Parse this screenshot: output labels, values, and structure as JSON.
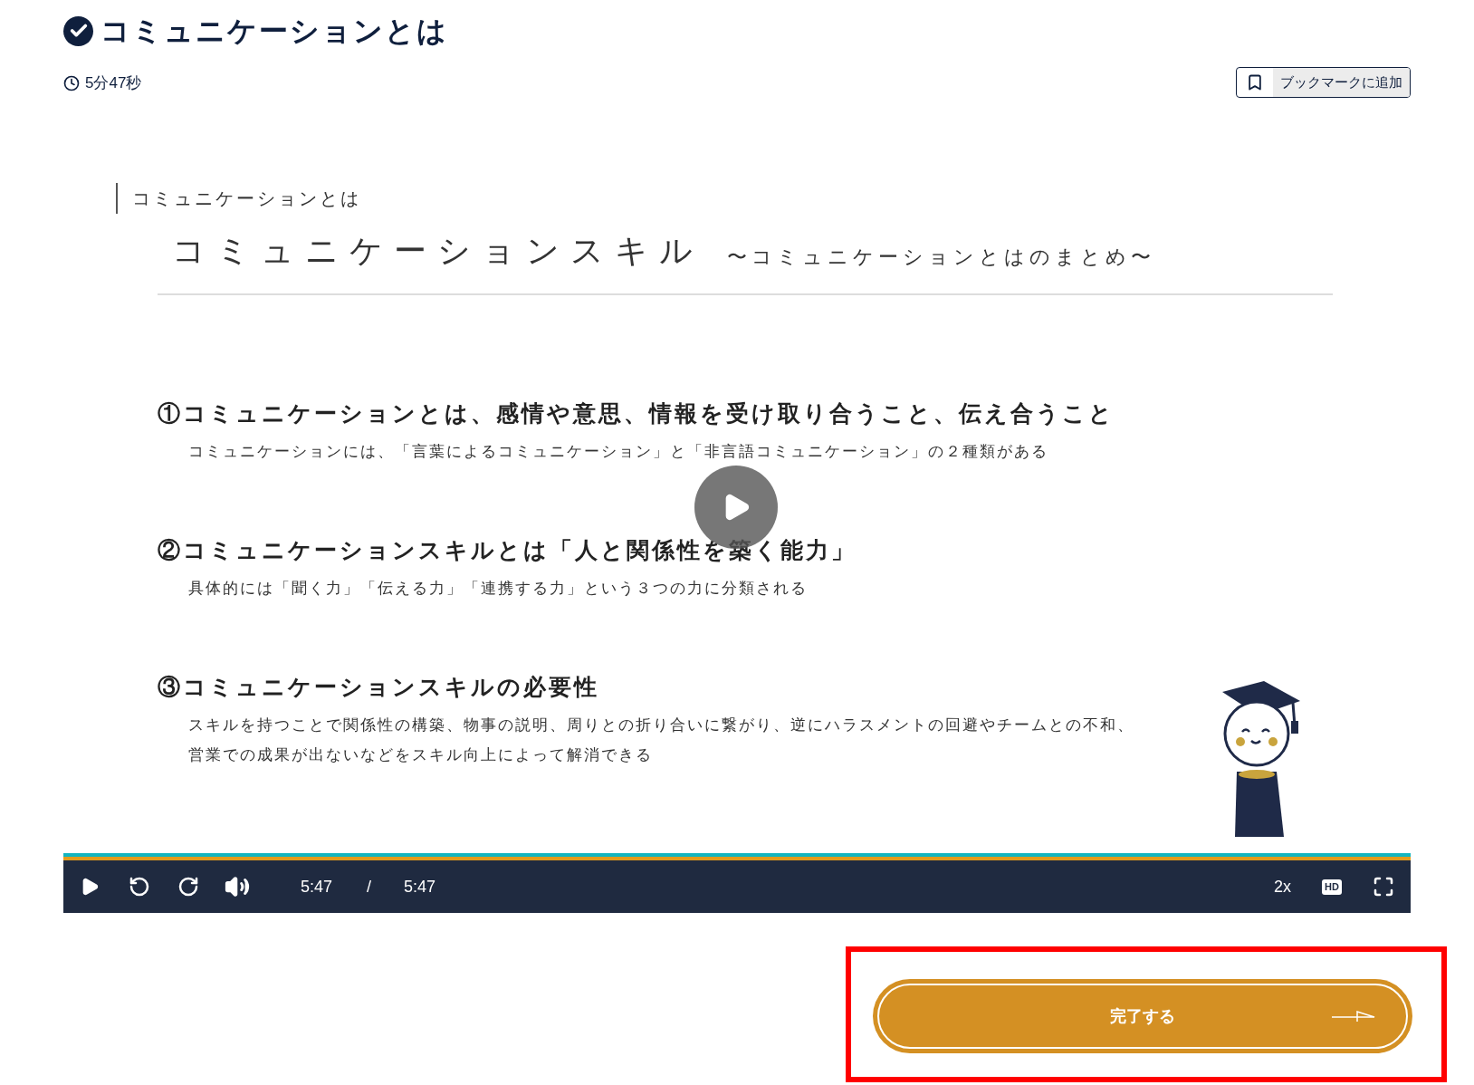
{
  "lesson": {
    "title": "コミュニケーションとは",
    "completed": true,
    "duration": "5分47秒",
    "bookmark_button": "ブックマークに追加"
  },
  "slide": {
    "section": "コミュニケーションとは",
    "heading": "コミュニケーションスキル",
    "subheading": "〜コミュニケーションとはのまとめ〜",
    "points": [
      {
        "title": "①コミュニケーションとは、感情や意思、情報を受け取り合うこと、伝え合うこと",
        "lines": [
          "コミュニケーションには、「言葉によるコミュニケーション」と「非言語コミュニケーション」の２種類がある"
        ]
      },
      {
        "title": "②コミュニケーションスキルとは「人と関係性を築く能力」",
        "lines": [
          "具体的には「聞く力」「伝える力」「連携する力」という３つの力に分類される"
        ]
      },
      {
        "title": "③コミュニケーションスキルの必要性",
        "lines": [
          "スキルを持つことで関係性の構築、物事の説明、周りとの折り合いに繋がり、逆にハラスメントの回避やチームとの不和、",
          "営業での成果が出ないなどをスキル向上によって解消できる"
        ]
      }
    ]
  },
  "player": {
    "playing": false,
    "progress": {
      "level": 1
    },
    "current_time": "5:47",
    "separator": "/",
    "total_time": "5:47",
    "speed": "2x",
    "hd": "HD"
  },
  "complete_button": {
    "label": "完了する",
    "highlighted": true
  }
}
